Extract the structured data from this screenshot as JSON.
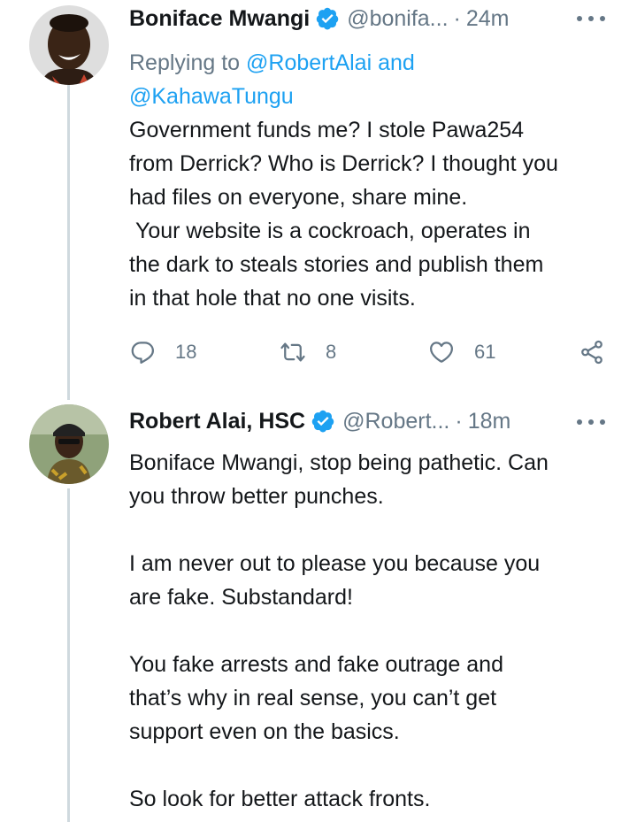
{
  "tweets": [
    {
      "author_name": "Boniface Mwangi",
      "handle": "@bonifa...",
      "separator": "·",
      "time": "24m",
      "replying_prefix": "Replying to ",
      "mention_1": "@RobertAlai",
      "reply_and": " and",
      "mention_2": "@KahawaTungu",
      "text": "Government funds me? I stole Pawa254\nfrom Derrick? Who is Derrick? I thought you\nhad files on everyone, share mine.\n Your website is a cockroach, operates in\nthe dark to steals stories and publish them\nin that hole that no one visits.",
      "reply_count": "18",
      "retweet_count": "8",
      "like_count": "61",
      "icons": {
        "avatar": "avatar-boniface",
        "verified": "verified-badge-icon",
        "more": "more-icon",
        "reply": "reply-icon",
        "retweet": "retweet-icon",
        "like": "like-icon",
        "share": "share-icon"
      }
    },
    {
      "author_name": "Robert Alai, HSC",
      "handle": "@Robert...",
      "separator": "·",
      "time": "18m",
      "text": "Boniface Mwangi, stop being pathetic. Can\nyou throw better punches.\n\nI am never out to please you because you\nare fake. Substandard!\n\nYou fake arrests and fake outrage and\nthat’s why in real sense, you can’t get\nsupport even on the basics.\n\nSo look for better attack fronts.",
      "icons": {
        "avatar": "avatar-robert",
        "verified": "verified-badge-icon",
        "more": "more-icon"
      }
    }
  ],
  "colors": {
    "text": "#14171a",
    "secondary": "#657786",
    "link": "#1da1f2",
    "verified": "#1da1f2",
    "thread_line": "#cfd9de",
    "background": "#ffffff"
  }
}
